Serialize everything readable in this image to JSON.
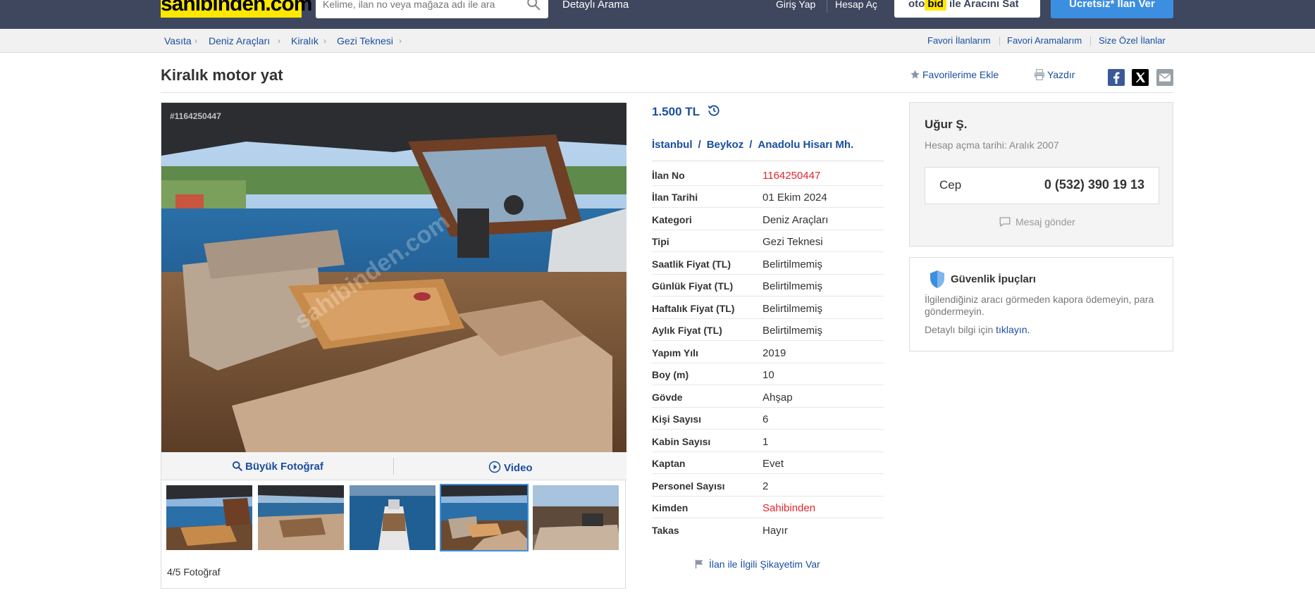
{
  "header": {
    "logo": "sahibinden.com",
    "search_placeholder": "Kelime, ilan no veya mağaza adı ile ara",
    "detailed_search": "Detaylı Arama",
    "login": "Giriş Yap",
    "register": "Hesap Aç",
    "otobid_brand_a": "oto",
    "otobid_brand_b": "bid",
    "otobid_text": "ile Aracını Sat",
    "post_ad": "Ücretsiz* İlan Ver"
  },
  "breadcrumb": [
    "Vasıta",
    "Deniz Araçları",
    "Kiralık",
    "Gezi Teknesi"
  ],
  "top_right_links": [
    "Favori İlanlarım",
    "Favori Aramalarım",
    "Size Özel İlanlar"
  ],
  "listing": {
    "title": "Kiralık motor yat",
    "add_favorite": "Favorilerime Ekle",
    "print": "Yazdır",
    "photo_id": "#1164250447",
    "watermark": "sahibinden.com",
    "big_photo": "Büyük Fotoğraf",
    "video": "Video",
    "photo_count": "4/5 Fotoğraf",
    "price": "1.500 TL",
    "location": [
      "İstanbul",
      "Beykoz",
      "Anadolu Hisarı Mh."
    ],
    "location_sep": "/",
    "specs": [
      {
        "label": "İlan No",
        "value": "1164250447"
      },
      {
        "label": "İlan Tarihi",
        "value": "01 Ekim 2024"
      },
      {
        "label": "Kategori",
        "value": "Deniz Araçları"
      },
      {
        "label": "Tipi",
        "value": "Gezi Teknesi"
      },
      {
        "label": "Saatlik Fiyat (TL)",
        "value": "Belirtilmemiş"
      },
      {
        "label": "Günlük Fiyat (TL)",
        "value": "Belirtilmemiş"
      },
      {
        "label": "Haftalık Fiyat (TL)",
        "value": "Belirtilmemiş"
      },
      {
        "label": "Aylık Fiyat (TL)",
        "value": "Belirtilmemiş"
      },
      {
        "label": "Yapım Yılı",
        "value": "2019"
      },
      {
        "label": "Boy (m)",
        "value": "10"
      },
      {
        "label": "Gövde",
        "value": "Ahşap"
      },
      {
        "label": "Kişi Sayısı",
        "value": "6"
      },
      {
        "label": "Kabin Sayısı",
        "value": "1"
      },
      {
        "label": "Kaptan",
        "value": "Evet"
      },
      {
        "label": "Personel Sayısı",
        "value": "2"
      },
      {
        "label": "Kimden",
        "value": "Sahibinden"
      },
      {
        "label": "Takas",
        "value": "Hayır"
      }
    ],
    "complaint": "İlan ile İlgili Şikayetim Var"
  },
  "seller": {
    "name": "Uğur Ş.",
    "since": "Hesap açma tarihi: Aralık 2007",
    "phone_label": "Cep",
    "phone": "0 (532) 390 19 13",
    "message": "Mesaj gönder"
  },
  "tips": {
    "title": "Güvenlik İpuçları",
    "text": "İlgilendiğiniz aracı görmeden kapora ödemeyin, para göndermeyin.",
    "more_prefix": "Detaylı bilgi için",
    "more_link": "tıklayın."
  },
  "colors": {
    "header_bg": "#3f475f",
    "brand_yellow": "#ffe800",
    "link_blue": "#1b4ea0",
    "accent_blue": "#3c8fe0",
    "red": "#e4252d"
  }
}
